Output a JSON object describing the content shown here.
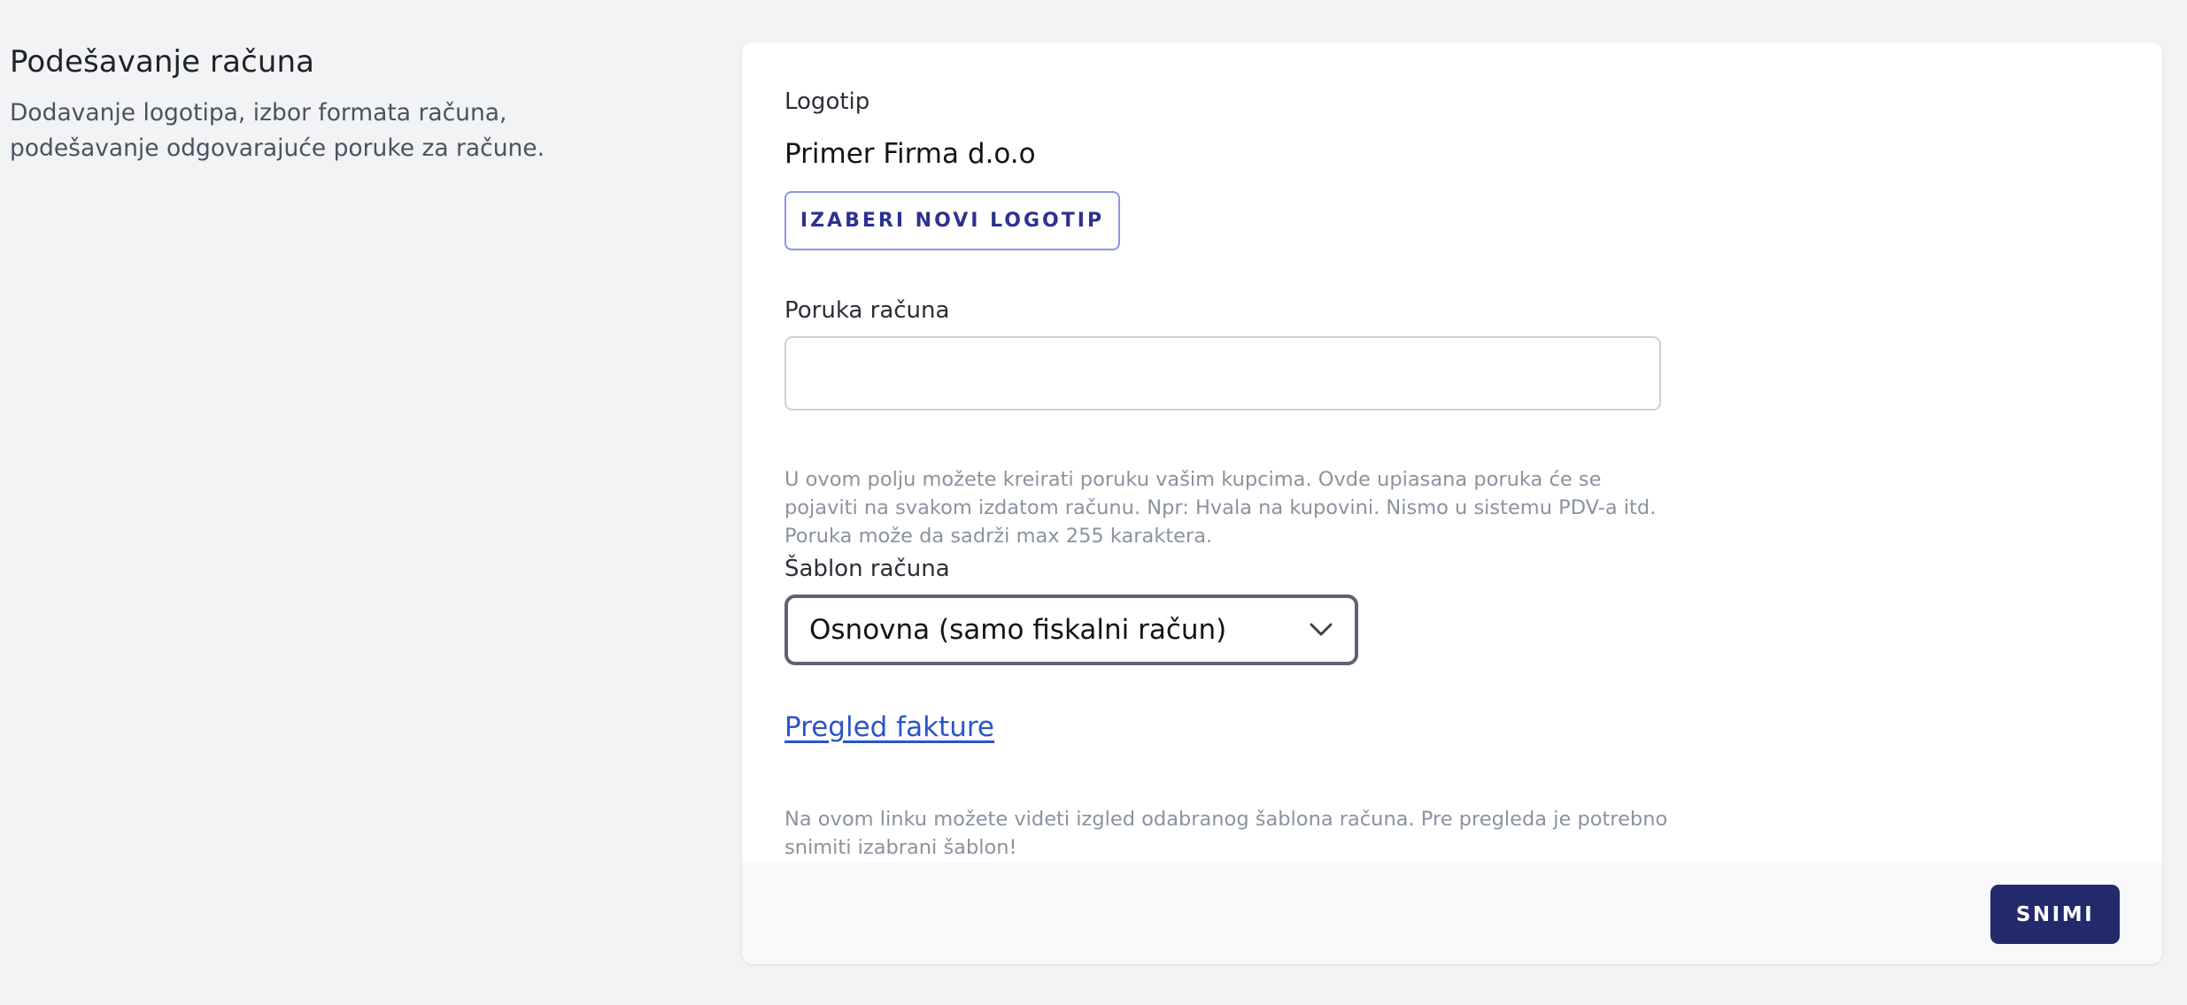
{
  "section": {
    "title": "Podešavanje računa",
    "description": "Dodavanje logotipa, izbor formata računa, podešavanje odgovarajuće poruke za račune."
  },
  "logo": {
    "label": "Logotip",
    "company_name": "Primer Firma d.o.o",
    "button_label": "IZABERI NOVI LOGOTIP"
  },
  "message": {
    "label": "Poruka računa",
    "value": "",
    "help": "U ovom polju možete kreirati poruku vašim kupcima. Ovde upiasana poruka će se pojaviti na svakom izdatom računu. Npr: Hvala na kupovini. Nismo u sistemu PDV-a itd. Poruka može da sadrži max 255 karaktera."
  },
  "template": {
    "label": "Šablon računa",
    "selected": "Osnovna (samo fiskalni račun)",
    "icon": "chevron-down-icon"
  },
  "preview": {
    "link_label": "Pregled fakture",
    "help": "Na ovom linku možete videti izgled odabranog šablona računa. Pre pregleda je potrebno snimiti izabrani šablon!"
  },
  "footer": {
    "save_label": "SNIMI"
  },
  "colors": {
    "primary": "#232a6c",
    "link": "#2a55c9",
    "outline_button_border": "#8a96e6",
    "page_background": "#f2f3f5"
  }
}
